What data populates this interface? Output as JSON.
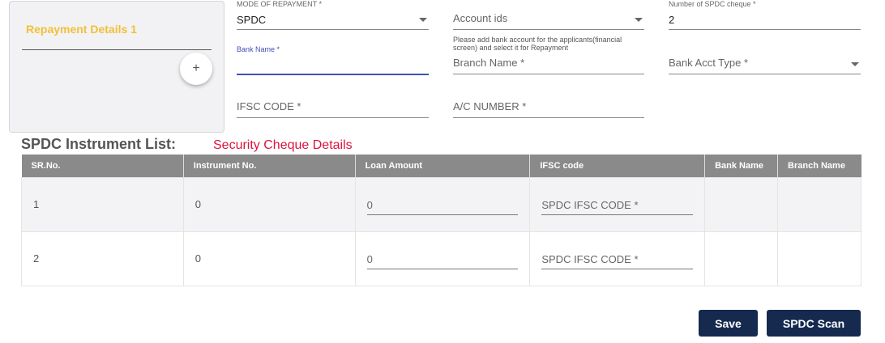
{
  "repayment_card": {
    "title": "Repayment Details 1",
    "add_label": "+"
  },
  "form": {
    "mode_of_repayment": {
      "label": "MODE OF REPAYMENT *",
      "value": "SPDC"
    },
    "account_ids": {
      "placeholder": "Account ids",
      "hint": "Please add bank account for the applicants(financial screen) and select it for Repayment"
    },
    "num_spdc_cheque": {
      "label": "Number of SPDC cheque *",
      "value": "2"
    },
    "bank_name": {
      "label": "Bank Name *",
      "value": ""
    },
    "branch_name": {
      "placeholder": "Branch Name  *"
    },
    "bank_acct_type": {
      "placeholder": "Bank Acct Type *"
    },
    "ifsc_code": {
      "placeholder": "IFSC CODE *"
    },
    "ac_number": {
      "placeholder": "A/C NUMBER *"
    }
  },
  "instrument_list": {
    "title": "SPDC Instrument List:",
    "subtitle": "Security Cheque Details",
    "columns": [
      "SR.No.",
      "Instrument No.",
      "Loan Amount",
      "IFSC code",
      "Bank Name",
      "Branch Name"
    ],
    "rows": [
      {
        "sr": "1",
        "instrument": "0",
        "loan_amount": "0",
        "ifsc_placeholder": "SPDC IFSC CODE *",
        "bank_name": "",
        "branch_name": ""
      },
      {
        "sr": "2",
        "instrument": "0",
        "loan_amount": "0",
        "ifsc_placeholder": "SPDC IFSC CODE *",
        "bank_name": "",
        "branch_name": ""
      }
    ]
  },
  "actions": {
    "save": "Save",
    "spdc_scan": "SPDC Scan"
  }
}
